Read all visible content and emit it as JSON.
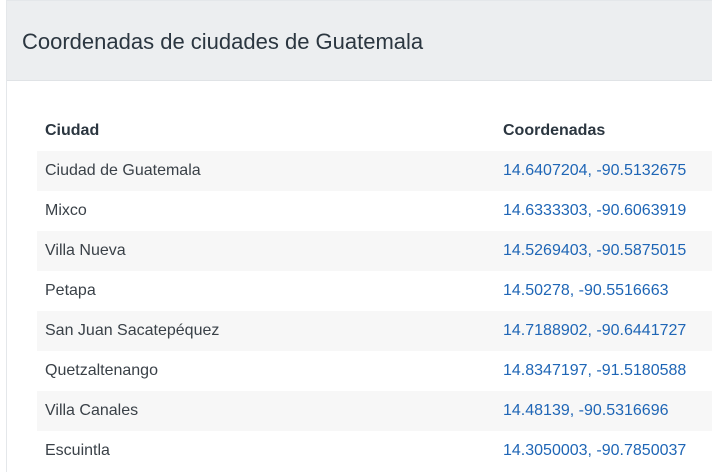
{
  "panel": {
    "title": "Coordenadas de ciudades de Guatemala"
  },
  "table": {
    "headers": {
      "city": "Ciudad",
      "coords": "Coordenadas"
    },
    "rows": [
      {
        "city": "Ciudad de Guatemala",
        "coords": "14.6407204, -90.5132675"
      },
      {
        "city": "Mixco",
        "coords": "14.6333303, -90.6063919"
      },
      {
        "city": "Villa Nueva",
        "coords": "14.5269403, -90.5875015"
      },
      {
        "city": "Petapa",
        "coords": "14.50278, -90.5516663"
      },
      {
        "city": "San Juan Sacatepéquez",
        "coords": "14.7188902, -90.6441727"
      },
      {
        "city": "Quetzaltenango",
        "coords": "14.8347197, -91.5180588"
      },
      {
        "city": "Villa Canales",
        "coords": "14.48139, -90.5316696"
      },
      {
        "city": "Escuintla",
        "coords": "14.3050003, -90.7850037"
      }
    ]
  },
  "colors": {
    "link": "#1f66b6",
    "header_bg": "#eceef0",
    "stripe": "#f7f7f7"
  }
}
